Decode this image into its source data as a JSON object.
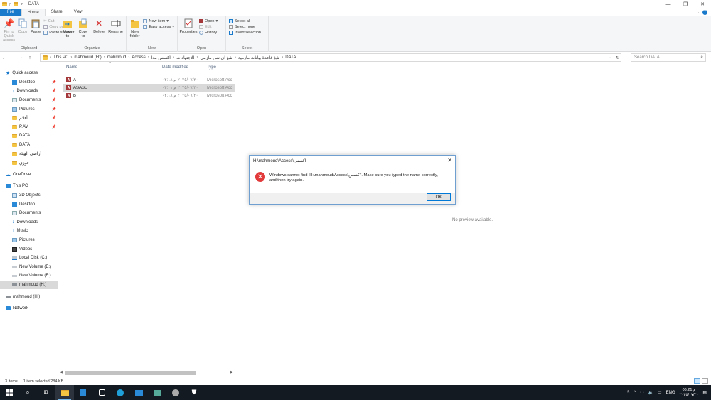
{
  "window": {
    "title": "DATA",
    "controls": [
      "—",
      "❐",
      "✕"
    ]
  },
  "tabs": [
    {
      "label": "File"
    },
    {
      "label": "Home"
    },
    {
      "label": "Share"
    },
    {
      "label": "View"
    }
  ],
  "ribbon": {
    "clipboard": {
      "label": "Clipboard",
      "pin": "Pin to Quick access",
      "copy": "Copy",
      "paste": "Paste",
      "cut": "Cut",
      "copy_path": "Copy path",
      "paste_shortcut": "Paste shortcut"
    },
    "organize": {
      "label": "Organize",
      "move_to": "Move to",
      "copy_to": "Copy to",
      "delete": "Delete",
      "rename": "Rename"
    },
    "new": {
      "label": "New",
      "new_folder": "New folder",
      "new_item": "New item",
      "easy_access": "Easy access"
    },
    "open": {
      "label": "Open",
      "properties": "Properties",
      "open": "Open",
      "edit": "Edit",
      "history": "History"
    },
    "select": {
      "label": "Select",
      "select_all": "Select all",
      "select_none": "Select none",
      "invert": "Invert selection"
    }
  },
  "address": {
    "crumbs": [
      "This PC",
      "mahmoud (H:)",
      "mahmoud",
      "Access",
      "اكسس مدا",
      "للاجتهادات",
      "شغ اي شن مازمي",
      "شغ قاعدة بيانات مازمية",
      "DATA"
    ],
    "search_placeholder": "Search DATA"
  },
  "navpane": {
    "quick_access": "Quick access",
    "quick_items": [
      {
        "label": "Desktop",
        "pinned": true
      },
      {
        "label": "Downloads",
        "pinned": true
      },
      {
        "label": "Documents",
        "pinned": true
      },
      {
        "label": "Pictures",
        "pinned": true
      },
      {
        "label": "أفلام",
        "pinned": true
      },
      {
        "label": "P.AV",
        "pinned": true
      },
      {
        "label": "DATA",
        "pinned": false
      },
      {
        "label": "DATA",
        "pinned": false
      },
      {
        "label": "أراضي الهيئة",
        "pinned": false
      },
      {
        "label": "فوزي",
        "pinned": false
      }
    ],
    "onedrive": "OneDrive",
    "this_pc": "This PC",
    "pc_items": [
      "3D Objects",
      "Desktop",
      "Documents",
      "Downloads",
      "Music",
      "Pictures",
      "Videos",
      "Local Disk (C:)",
      "New Volume (E:)",
      "New Volume (F:)",
      "mahmoud (H:)"
    ],
    "drive": "mahmoud (H:)",
    "network": "Network"
  },
  "filelist": {
    "columns": {
      "name": "Name",
      "date": "Date modified",
      "type": "Type"
    },
    "rows": [
      {
        "name": "A",
        "date": "٢٠٢٥/٠٧/٢٠ م ٠٢:١٨",
        "type": "Microsoft Acc",
        "selected": false
      },
      {
        "name": "ASASE",
        "date": "٢٠٢٥/٠٧/٢٠ م ٠٢:٠١",
        "type": "Microsoft Acc",
        "selected": true
      },
      {
        "name": "B",
        "date": "٢٠٢٥/٠٧/٢٠ م ٠٢:١٨",
        "type": "Microsoft Acc",
        "selected": false
      }
    ]
  },
  "preview": {
    "text": "No preview available."
  },
  "status": {
    "items": "3 items",
    "selection": "1 item selected  284 KB"
  },
  "dialog": {
    "title": "H:\\mahmoud\\Access\\اكسس",
    "message": "Windows cannot find 'H:\\mahmoud\\Access\\اكسس'. Make sure you typed the name correctly, and then try again.",
    "ok": "OK"
  },
  "taskbar": {
    "lang": "ENG",
    "time": "06:21 م",
    "date": "٢٠٢٥/٠٧/٢٠"
  }
}
